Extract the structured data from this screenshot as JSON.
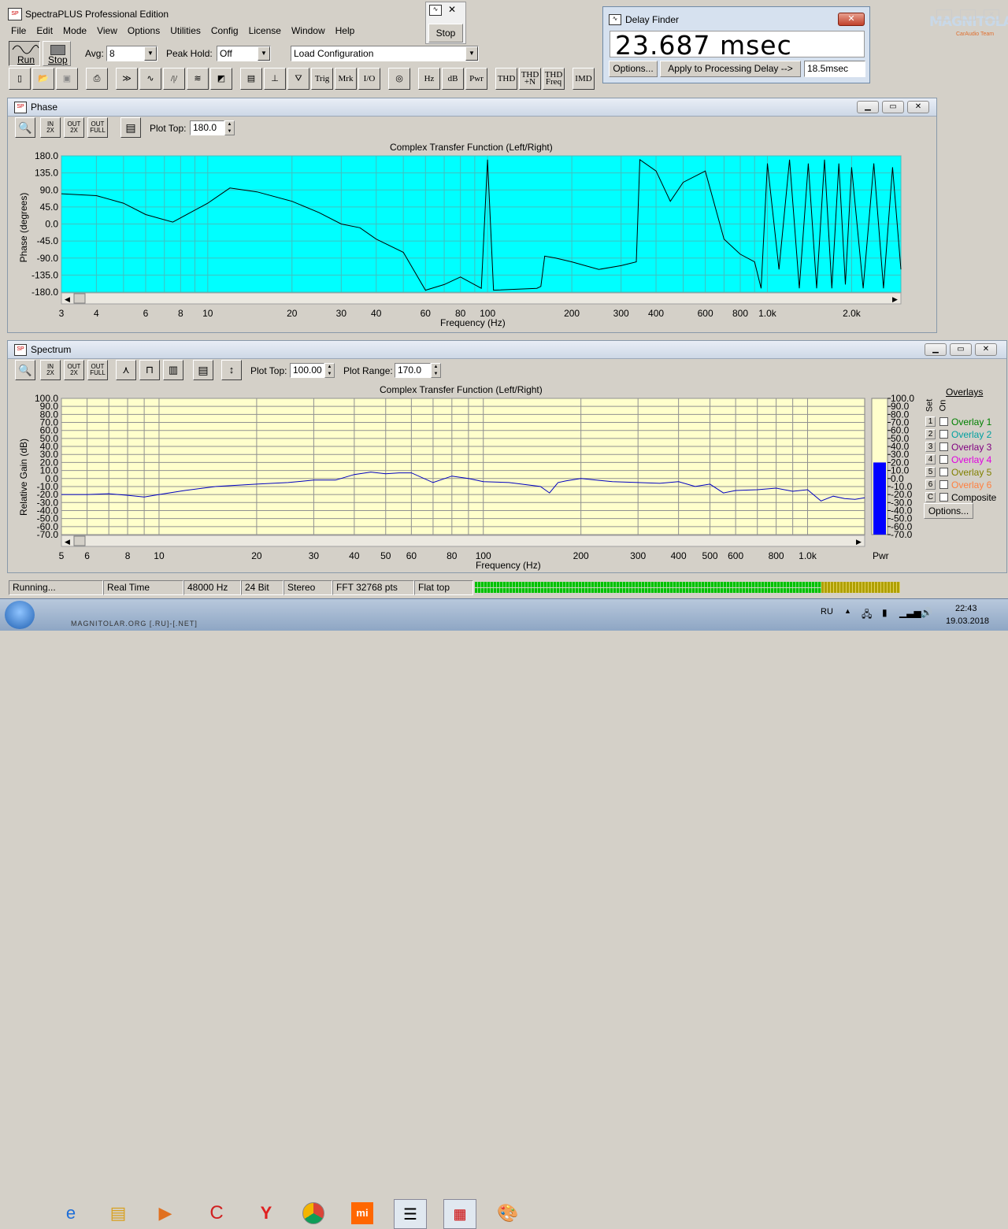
{
  "app": {
    "title": "SpectraPLUS Professional Edition"
  },
  "menu": [
    "File",
    "Edit",
    "Mode",
    "View",
    "Options",
    "Utilities",
    "Config",
    "License",
    "Window",
    "Help"
  ],
  "toolbar": {
    "run_label": "Run",
    "stop_label": "Stop",
    "avg_label": "Avg:",
    "avg_value": "8",
    "peak_hold_label": "Peak Hold:",
    "peak_hold_value": "Off",
    "load_config": "Load Configuration",
    "row2": [
      "Trig",
      "Mrk",
      "I/O",
      "Hz",
      "dB",
      "Pwr",
      "THD",
      "THD +N",
      "THD Freq",
      "IMD"
    ]
  },
  "floating_stop": {
    "label": "Stop"
  },
  "delay_finder": {
    "title": "Delay Finder",
    "value": "23.687 msec",
    "options_label": "Options...",
    "apply_label": "Apply to Processing Delay -->",
    "processing_delay": "18.5msec"
  },
  "watermark": {
    "text": "MAGNITOLA",
    "sub": "CarAudio Team"
  },
  "phase_window": {
    "title": "Phase",
    "plot_top_label": "Plot Top:",
    "plot_top_value": "180.0",
    "chart_title": "Complex Transfer Function (Left/Right)",
    "ylabel": "Phase (degrees)",
    "xlabel": "Frequency (Hz)",
    "y_ticks": [
      "180.0",
      "135.0",
      "90.0",
      "45.0",
      "0.0",
      "-45.0",
      "-90.0",
      "-135.0",
      "-180.0"
    ],
    "x_ticks": [
      "3",
      "4",
      "6",
      "8",
      "10",
      "20",
      "30",
      "40",
      "60",
      "80",
      "100",
      "200",
      "300",
      "400",
      "600",
      "800",
      "1.0k",
      "2.0k"
    ],
    "bg_color": "#00ffff"
  },
  "spectrum_window": {
    "title": "Spectrum",
    "plot_top_label": "Plot Top:",
    "plot_top_value": "100.00",
    "plot_range_label": "Plot Range:",
    "plot_range_value": "170.0",
    "chart_title": "Complex Transfer Function (Left/Right)",
    "ylabel": "Relative Gain (dB)",
    "xlabel": "Frequency (Hz)",
    "y_ticks": [
      "100.0",
      "90.0",
      "80.0",
      "70.0",
      "60.0",
      "50.0",
      "40.0",
      "30.0",
      "20.0",
      "10.0",
      "0.0",
      "-10.0",
      "-20.0",
      "-30.0",
      "-40.0",
      "-50.0",
      "-60.0",
      "-70.0"
    ],
    "x_ticks": [
      "5",
      "6",
      "8",
      "10",
      "20",
      "30",
      "40",
      "50",
      "60",
      "80",
      "100",
      "200",
      "300",
      "400",
      "500",
      "600",
      "800",
      "1.0k"
    ],
    "bg_color": "#ffffcc",
    "pwr_label": "Pwr",
    "pwr_ticks": [
      "100.0",
      "90.0",
      "80.0",
      "70.0",
      "60.0",
      "50.0",
      "40.0",
      "30.0",
      "20.0",
      "10.0",
      "0.0",
      "-10.0",
      "-20.0",
      "-30.0",
      "-40.0",
      "-50.0",
      "-60.0",
      "-70.0"
    ],
    "pwr_level_db": 20
  },
  "overlays": {
    "header": "Overlays",
    "set_label": "Set",
    "on_label": "On",
    "items": [
      {
        "num": "1",
        "label": "Overlay 1",
        "color": "#008000"
      },
      {
        "num": "2",
        "label": "Overlay 2",
        "color": "#00a0a0"
      },
      {
        "num": "3",
        "label": "Overlay 3",
        "color": "#800080"
      },
      {
        "num": "4",
        "label": "Overlay 4",
        "color": "#e000e0"
      },
      {
        "num": "5",
        "label": "Overlay 5",
        "color": "#808000"
      },
      {
        "num": "6",
        "label": "Overlay 6",
        "color": "#ff8040"
      },
      {
        "num": "C",
        "label": "Composite",
        "color": "#000000"
      }
    ],
    "options_label": "Options..."
  },
  "status_bar": [
    "Running...",
    "Real Time",
    "48000 Hz",
    "24 Bit",
    "Stereo",
    "FFT 32768 pts",
    "Flat top"
  ],
  "taskbar": {
    "lang": "RU",
    "time": "22:43",
    "date": "19.03.2018",
    "watermark": "MAGNITOLAR.ORG [.RU]-[.NET]"
  },
  "chart_data": [
    {
      "type": "line",
      "title": "Complex Transfer Function (Left/Right)",
      "xlabel": "Frequency (Hz)",
      "ylabel": "Phase (degrees)",
      "ylim": [
        -180,
        180
      ],
      "xlim": [
        3,
        3000
      ],
      "x_scale": "log",
      "series": [
        {
          "x": [
            3,
            4,
            5,
            6,
            7.5,
            10,
            12,
            15,
            20,
            25,
            30,
            35,
            40,
            50,
            60,
            70,
            80,
            95,
            100,
            105,
            150,
            155,
            160,
            175,
            200,
            250,
            300,
            340,
            350,
            400,
            450,
            500,
            600,
            700,
            800,
            900,
            950,
            1000,
            1100,
            1200,
            1300,
            1400,
            1500,
            1600,
            1700,
            1800,
            1900,
            2000,
            2200,
            2400,
            2600,
            2800,
            3000
          ],
          "y": [
            80,
            75,
            55,
            25,
            5,
            55,
            95,
            85,
            60,
            30,
            0,
            -10,
            -40,
            -75,
            -175,
            -160,
            -140,
            -170,
            170,
            -175,
            -170,
            -165,
            -85,
            -90,
            -100,
            -120,
            -110,
            -100,
            170,
            140,
            60,
            110,
            140,
            -40,
            -80,
            -100,
            -170,
            160,
            -120,
            170,
            -170,
            160,
            -170,
            170,
            -170,
            160,
            -160,
            150,
            -170,
            160,
            -170,
            150,
            -120
          ]
        }
      ]
    },
    {
      "type": "line",
      "title": "Complex Transfer Function (Left/Right)",
      "xlabel": "Frequency (Hz)",
      "ylabel": "Relative Gain (dB)",
      "ylim": [
        -70,
        100
      ],
      "xlim": [
        5,
        1500
      ],
      "x_scale": "log",
      "series": [
        {
          "x": [
            5,
            6,
            7,
            8,
            9,
            10,
            12,
            15,
            20,
            25,
            30,
            35,
            40,
            45,
            50,
            55,
            60,
            70,
            80,
            90,
            100,
            120,
            150,
            160,
            170,
            180,
            200,
            250,
            300,
            350,
            400,
            450,
            500,
            550,
            600,
            700,
            800,
            900,
            1000,
            1100,
            1200,
            1300,
            1400,
            1500
          ],
          "y": [
            -20,
            -20,
            -19,
            -21,
            -23,
            -20,
            -15,
            -10,
            -7,
            -5,
            -2,
            -2,
            5,
            8,
            6,
            7,
            7,
            -5,
            3,
            0,
            -4,
            -5,
            -10,
            -18,
            -5,
            -3,
            0,
            -4,
            -5,
            -6,
            -4,
            -10,
            -7,
            -18,
            -15,
            -14,
            -12,
            -16,
            -14,
            -28,
            -22,
            -25,
            -26,
            -24
          ]
        }
      ]
    }
  ]
}
